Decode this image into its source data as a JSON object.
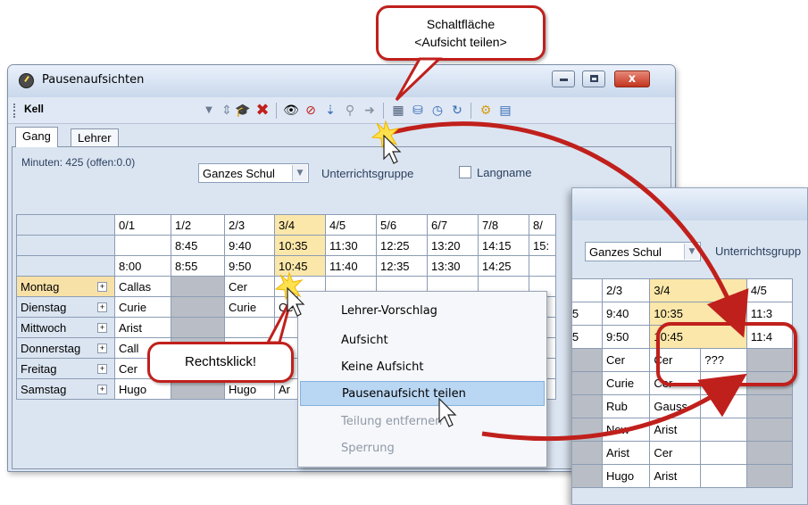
{
  "window": {
    "title": "Pausenaufsichten",
    "toolbar_select": "Kell",
    "caption_close": "x"
  },
  "toolbar_icons": [
    "hat-icon",
    "delete-icon",
    "eye-icon",
    "eye-off-icon",
    "split-supervision-icon",
    "supervisor-icon",
    "arrow-icon",
    "calculator-icon",
    "tree-icon",
    "clock-icon",
    "refresh-icon",
    "settings-icon",
    "print-preview-icon"
  ],
  "tabs": [
    {
      "label": "Gang",
      "active": true
    },
    {
      "label": "Lehrer",
      "active": false
    }
  ],
  "filter": {
    "minutes": "Minuten: 425 (offen:0.0)",
    "scope_select": "Ganzes Schul",
    "group_label": "Unterrichtsgruppe",
    "longname_label": "Langname"
  },
  "grid": {
    "periods": [
      "0/1",
      "1/2",
      "2/3",
      "3/4",
      "4/5",
      "5/6",
      "6/7",
      "7/8",
      "8/"
    ],
    "end_times": [
      "",
      "8:45",
      "9:40",
      "10:35",
      "11:30",
      "12:25",
      "13:20",
      "14:15",
      "15:"
    ],
    "start_times": [
      "8:00",
      "8:55",
      "9:50",
      "10:45",
      "11:40",
      "12:35",
      "13:30",
      "14:25",
      ""
    ],
    "rows": [
      {
        "day": "Montag",
        "cells": [
          "Callas",
          "",
          "Cer",
          "",
          "",
          "",
          "",
          "",
          ""
        ]
      },
      {
        "day": "Dienstag",
        "cells": [
          "Curie",
          "",
          "Curie",
          "Ce",
          "",
          "",
          "",
          "",
          ""
        ]
      },
      {
        "day": "Mittwoch",
        "cells": [
          "Arist",
          "",
          "",
          "",
          "",
          "",
          "",
          "",
          ""
        ]
      },
      {
        "day": "Donnerstag",
        "cells": [
          "Call",
          "",
          "",
          "",
          "",
          "",
          "",
          "",
          ""
        ]
      },
      {
        "day": "Freitag",
        "cells": [
          "Cer",
          "",
          "Arist",
          "Ce",
          "",
          "",
          "",
          "",
          ""
        ]
      },
      {
        "day": "Samstag",
        "cells": [
          "Hugo",
          "",
          "Hugo",
          "Ar",
          "",
          "",
          "",
          "",
          ""
        ]
      }
    ]
  },
  "context_menu": {
    "items": [
      {
        "label": "Lehrer-Vorschlag",
        "state": "normal"
      },
      {
        "label": "Aufsicht",
        "state": "normal"
      },
      {
        "label": "Keine Aufsicht",
        "state": "normal"
      },
      {
        "label": "Pausenaufsicht teilen",
        "state": "active"
      },
      {
        "label": "Teilung entfernen",
        "state": "disabled"
      },
      {
        "label": "Sperrung",
        "state": "disabled"
      }
    ]
  },
  "callouts": {
    "button_line1": "Schaltfläche",
    "button_line2": "<Aufsicht teilen>",
    "right_click": "Rechtsklick!"
  },
  "zoom": {
    "scope_select": "Ganzes Schul",
    "group_label": "Unterrichtsgrupp",
    "periods": [
      "/2",
      "2/3",
      "3/4",
      "",
      "4/5"
    ],
    "end_times": [
      ":45",
      "9:40",
      "10:35",
      "",
      "11:3"
    ],
    "start_times": [
      ":55",
      "9:50",
      "10:45",
      "",
      "11:4"
    ],
    "rows": [
      [
        "",
        "Cer",
        "Cer",
        "???",
        ""
      ],
      [
        "",
        "Curie",
        "Cer",
        "",
        ""
      ],
      [
        "",
        "Rub",
        "Gauss",
        "",
        ""
      ],
      [
        "",
        "New",
        "Arist",
        "",
        ""
      ],
      [
        "",
        "Arist",
        "Cer",
        "",
        ""
      ],
      [
        "",
        "Hugo",
        "Arist",
        "",
        ""
      ]
    ]
  },
  "colors": {
    "accent_red": "#c0201c",
    "highlight_yellow": "#fbe7a9",
    "menu_active": "#b9d6f3"
  }
}
